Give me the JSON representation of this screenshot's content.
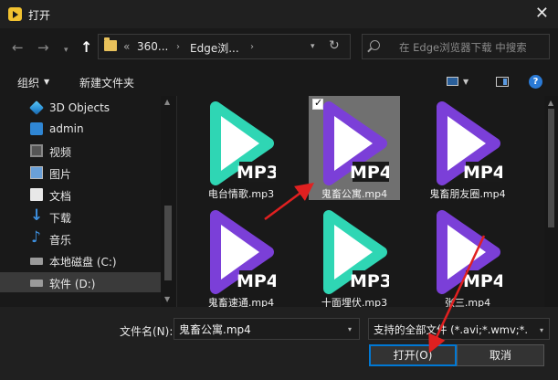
{
  "window": {
    "title": "打开",
    "close_label": "✕"
  },
  "nav": {
    "back": "←",
    "forward": "→",
    "dropdown": "▾",
    "up": "↑"
  },
  "address": {
    "ellipsis": "«",
    "crumbs": [
      "360...",
      "Edge浏..."
    ],
    "separator": "›",
    "dropdown": "▾",
    "refresh": "↻"
  },
  "search": {
    "placeholder": "在 Edge浏览器下载 中搜索"
  },
  "toolbar": {
    "organize": "组织",
    "organize_dd": "▼",
    "new_folder": "新建文件夹",
    "help": "?"
  },
  "sidebar": {
    "items": [
      {
        "label": "3D Objects",
        "icon": "cube-icon"
      },
      {
        "label": "admin",
        "icon": "user-folder-icon"
      },
      {
        "label": "视频",
        "icon": "video-icon"
      },
      {
        "label": "图片",
        "icon": "picture-icon"
      },
      {
        "label": "文档",
        "icon": "document-icon"
      },
      {
        "label": "下载",
        "icon": "download-icon"
      },
      {
        "label": "音乐",
        "icon": "music-icon"
      },
      {
        "label": "本地磁盘 (C:)",
        "icon": "drive-icon"
      },
      {
        "label": "软件 (D:)",
        "icon": "drive-icon",
        "selected": true
      }
    ]
  },
  "files": [
    {
      "name": "电台情歌.mp3",
      "badge": "MP3",
      "color": "#2fd6b4"
    },
    {
      "name": "鬼畜公寓.mp4",
      "badge": "MP4",
      "color": "#7b3fd8",
      "selected": true
    },
    {
      "name": "鬼畜朋友圈.mp4",
      "badge": "MP4",
      "color": "#7b3fd8"
    },
    {
      "name": "鬼畜速通.mp4",
      "badge": "MP4",
      "color": "#7b3fd8"
    },
    {
      "name": "十面埋伏.mp3",
      "badge": "MP3",
      "color": "#2fd6b4"
    },
    {
      "name": "张三.mp4",
      "badge": "MP4",
      "color": "#7b3fd8"
    }
  ],
  "bottom": {
    "filename_label": "文件名(N):",
    "filename_value": "鬼畜公寓.mp4",
    "filetype_value": "支持的全部文件 (*.avi;*.wmv;*.",
    "open_button": "打开(O)",
    "cancel_button": "取消",
    "dropdown": "▾"
  },
  "colors": {
    "accent": "#0078d4",
    "annotation": "#e02020"
  }
}
